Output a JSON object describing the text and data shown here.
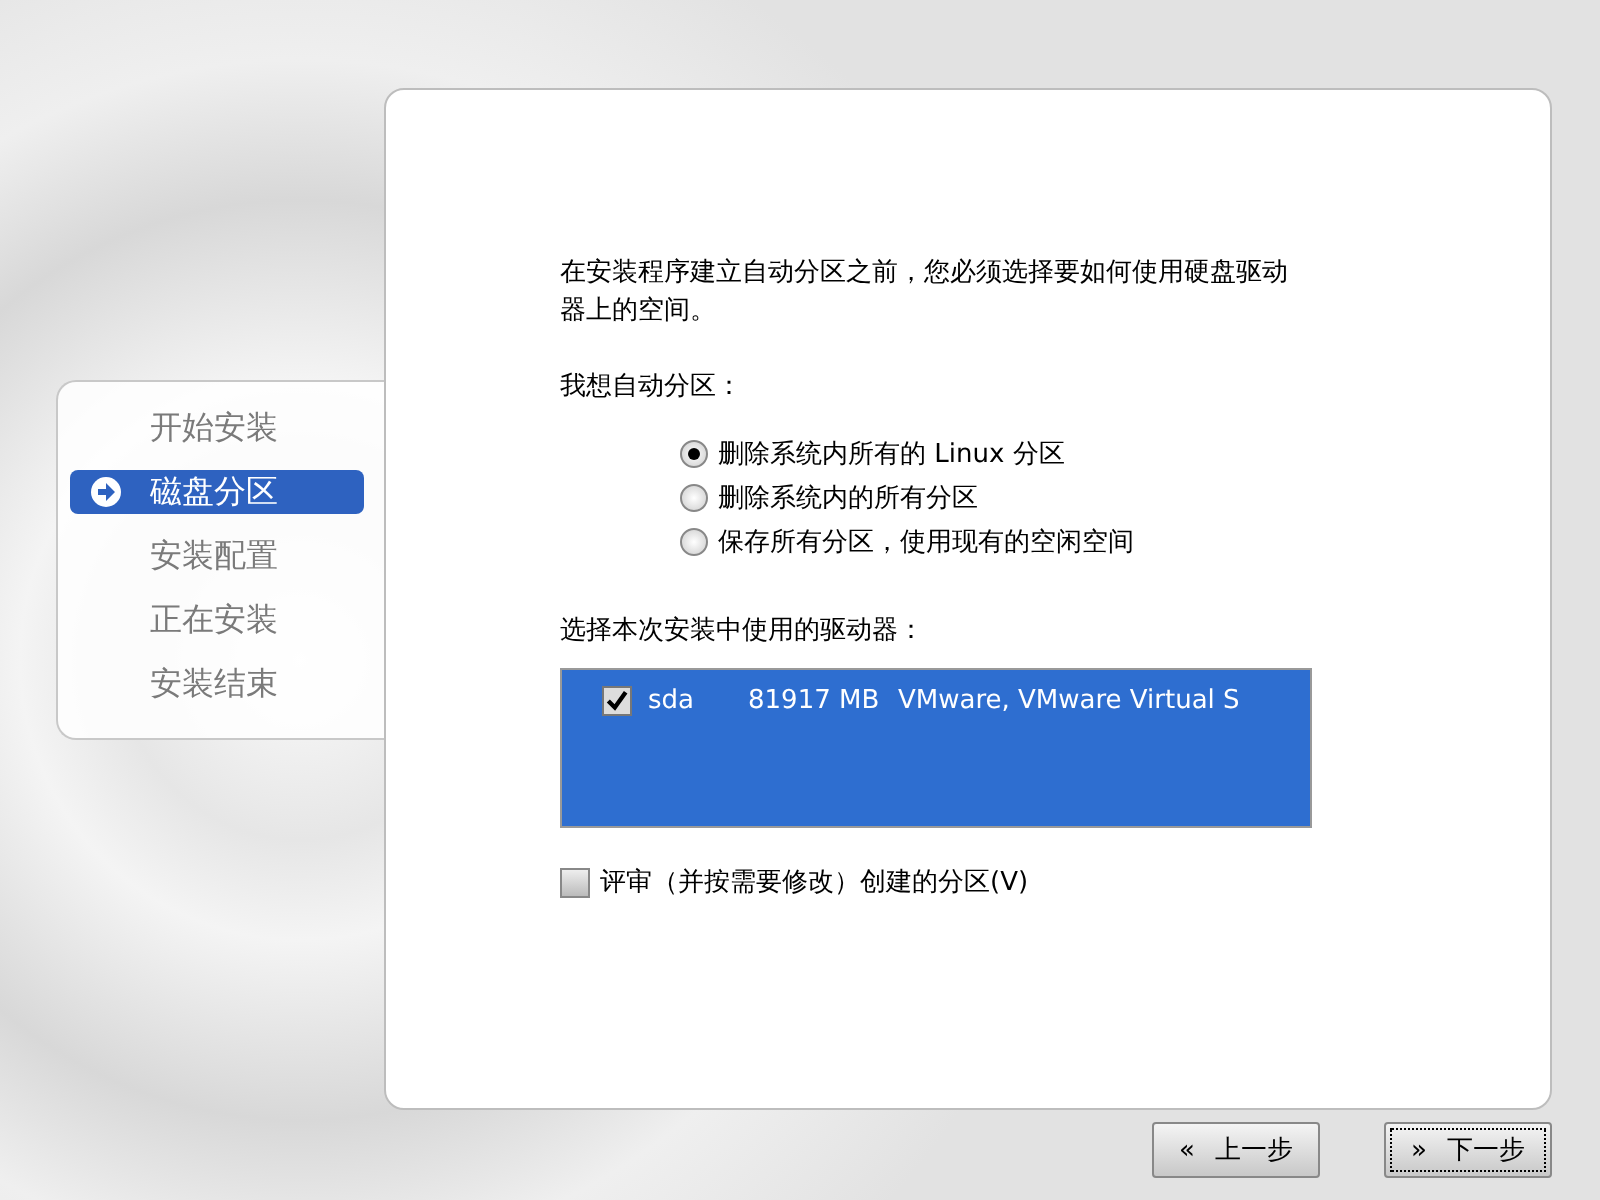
{
  "sidebar": {
    "items": [
      {
        "label": "开始安装",
        "selected": false
      },
      {
        "label": "磁盘分区",
        "selected": true
      },
      {
        "label": "安装配置",
        "selected": false
      },
      {
        "label": "正在安装",
        "selected": false
      },
      {
        "label": "安装结束",
        "selected": false
      }
    ]
  },
  "intro": "在安装程序建立自动分区之前，您必须选择要如何使用硬盘驱动器上的空间。",
  "partition_label": "我想自动分区：",
  "options": [
    {
      "label": "删除系统内所有的 Linux 分区",
      "selected": true
    },
    {
      "label": "删除系统内的所有分区",
      "selected": false
    },
    {
      "label": "保存所有分区，使用现有的空闲空间",
      "selected": false
    }
  ],
  "drives_label": "选择本次安装中使用的驱动器：",
  "drives": [
    {
      "name": "sda",
      "size": "81917 MB",
      "model": "VMware, VMware Virtual S",
      "checked": true
    }
  ],
  "review": {
    "label": "评审（并按需要修改）创建的分区(V)",
    "checked": false
  },
  "buttons": [
    {
      "icon": "«",
      "label": "上一步",
      "focused": false
    },
    {
      "icon": "»",
      "label": "下一步",
      "focused": true
    }
  ]
}
